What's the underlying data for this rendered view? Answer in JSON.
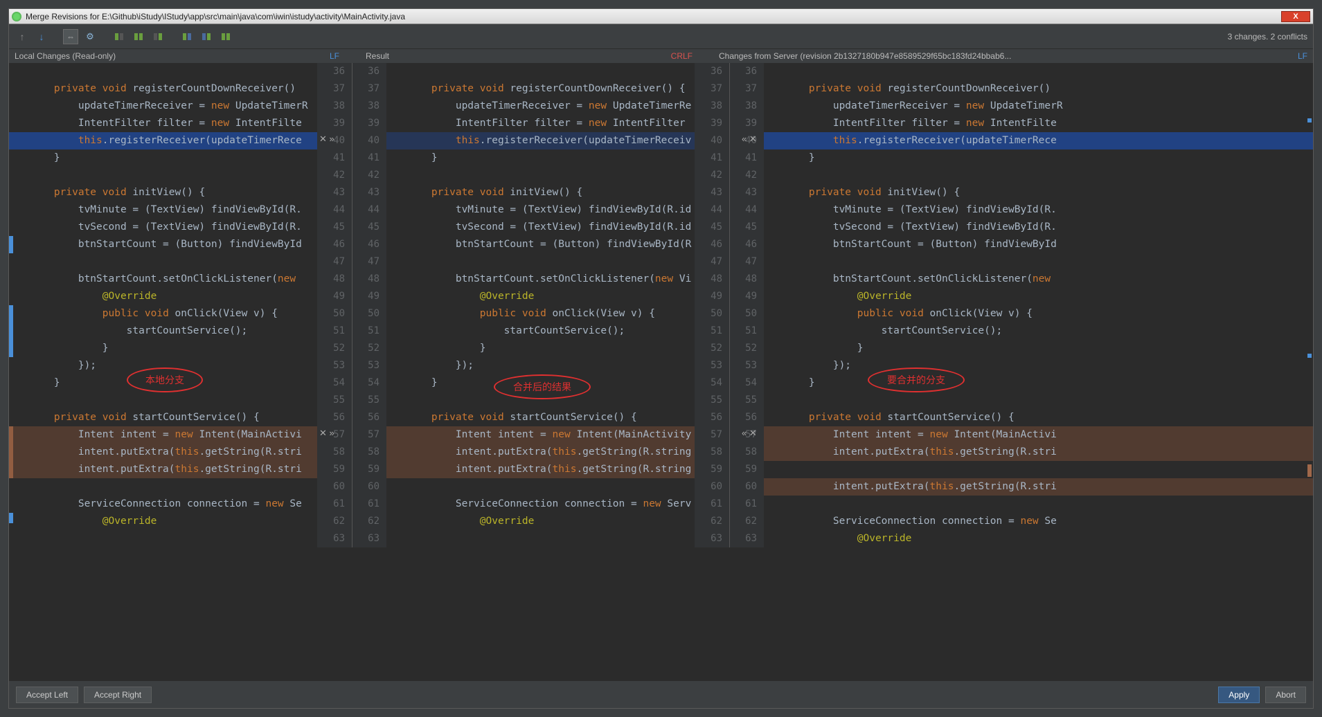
{
  "window": {
    "title": "Merge Revisions for E:\\Github\\iStudy\\IStudy\\app\\src\\main\\java\\com\\iwin\\istudy\\activity\\MainActivity.java",
    "close_label": "X"
  },
  "status": "3 changes. 2 conflicts",
  "headers": {
    "left": "Local Changes (Read-only)",
    "left_le": "LF",
    "mid": "Result",
    "mid_le": "CRLF",
    "right": "Changes from Server (revision 2b1327180b947e8589529f65bc183fd24bbab6...",
    "right_le": "LF"
  },
  "line_numbers": [
    "36",
    "37",
    "38",
    "39",
    "40",
    "41",
    "42",
    "43",
    "44",
    "45",
    "46",
    "47",
    "48",
    "49",
    "50",
    "51",
    "52",
    "53",
    "54",
    "55",
    "56",
    "57",
    "58",
    "59",
    "60",
    "61",
    "62",
    "63"
  ],
  "code_left": [
    "",
    "    private void registerCountDownReceiver()",
    "        updateTimerReceiver = new UpdateTimerR",
    "        IntentFilter filter = new IntentFilte",
    "        this.registerReceiver(updateTimerRece",
    "    }",
    "",
    "    private void initView() {",
    "        tvMinute = (TextView) findViewById(R.",
    "        tvSecond = (TextView) findViewById(R.",
    "        btnStartCount = (Button) findViewById",
    "",
    "        btnStartCount.setOnClickListener(new ",
    "            @Override",
    "            public void onClick(View v) {",
    "                startCountService();",
    "            }",
    "        });",
    "    }",
    "",
    "    private void startCountService() {",
    "        Intent intent = new Intent(MainActivi",
    "        intent.putExtra(this.getString(R.stri",
    "        intent.putExtra(this.getString(R.stri",
    "",
    "        ServiceConnection connection = new Se",
    "            @Override",
    ""
  ],
  "code_mid": [
    "",
    "    private void registerCountDownReceiver() {",
    "        updateTimerReceiver = new UpdateTimerRe",
    "        IntentFilter filter = new IntentFilter",
    "        this.registerReceiver(updateTimerReceiv",
    "    }",
    "",
    "    private void initView() {",
    "        tvMinute = (TextView) findViewById(R.id",
    "        tvSecond = (TextView) findViewById(R.id",
    "        btnStartCount = (Button) findViewById(R",
    "",
    "        btnStartCount.setOnClickListener(new Vi",
    "            @Override",
    "            public void onClick(View v) {",
    "                startCountService();",
    "            }",
    "        });",
    "    }",
    "",
    "    private void startCountService() {",
    "        Intent intent = new Intent(MainActivity",
    "        intent.putExtra(this.getString(R.string",
    "        intent.putExtra(this.getString(R.string",
    "",
    "        ServiceConnection connection = new Serv",
    "            @Override",
    ""
  ],
  "code_right": [
    "",
    "    private void registerCountDownReceiver()",
    "        updateTimerReceiver = new UpdateTimerR",
    "        IntentFilter filter = new IntentFilte",
    "        this.registerReceiver(updateTimerRece",
    "    }",
    "",
    "    private void initView() {",
    "        tvMinute = (TextView) findViewById(R.",
    "        tvSecond = (TextView) findViewById(R.",
    "        btnStartCount = (Button) findViewById",
    "",
    "        btnStartCount.setOnClickListener(new ",
    "            @Override",
    "            public void onClick(View v) {",
    "                startCountService();",
    "            }",
    "        });",
    "    }",
    "",
    "    private void startCountService() {",
    "        Intent intent = new Intent(MainActivi",
    "        intent.putExtra(this.getString(R.stri",
    "",
    "        intent.putExtra(this.getString(R.stri",
    "",
    "        ServiceConnection connection = new Se",
    "            @Override"
  ],
  "annotations": {
    "oval_left": "本地分支",
    "oval_mid": "合并后的结果",
    "oval_right": "要合并的分支"
  },
  "merge_controls": {
    "reject_accept_left": "✕ »",
    "reject_accept_right": "« ✕"
  },
  "footer": {
    "accept_left": "Accept Left",
    "accept_right": "Accept Right",
    "apply": "Apply",
    "abort": "Abort"
  }
}
